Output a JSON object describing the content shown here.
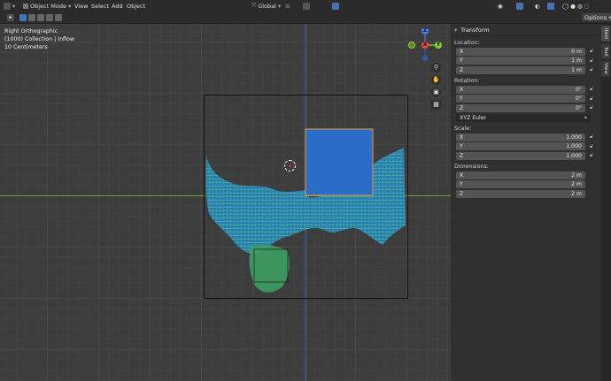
{
  "header": {
    "mode": "Object Mode",
    "menus": [
      "View",
      "Select",
      "Add",
      "Object"
    ],
    "orientation": "Global",
    "options": "Options"
  },
  "hud": {
    "view_name": "Right Orthographic",
    "collection": "(1000) Collection | Inflow",
    "scale": "10 Centimeters"
  },
  "gizmo": {
    "z": "Z",
    "y": "Y",
    "x": "X",
    "neg_y": "-Y"
  },
  "panel": {
    "title": "Transform",
    "location_label": "Location:",
    "location": [
      {
        "axis": "X",
        "value": "0 m"
      },
      {
        "axis": "Y",
        "value": "1 m"
      },
      {
        "axis": "Z",
        "value": "1 m"
      }
    ],
    "rotation_label": "Rotation:",
    "rotation": [
      {
        "axis": "X",
        "value": "0°"
      },
      {
        "axis": "Y",
        "value": "0°"
      },
      {
        "axis": "Z",
        "value": "0°"
      }
    ],
    "rotation_mode": "XYZ Euler",
    "scale_label": "Scale:",
    "scale": [
      {
        "axis": "X",
        "value": "1.000"
      },
      {
        "axis": "Y",
        "value": "1.000"
      },
      {
        "axis": "Z",
        "value": "1.000"
      }
    ],
    "dimensions_label": "Dimensions:",
    "dimensions": [
      {
        "axis": "X",
        "value": "2 m"
      },
      {
        "axis": "Y",
        "value": "2 m"
      },
      {
        "axis": "Z",
        "value": "2 m"
      }
    ]
  },
  "tabs": [
    "Item",
    "Tool",
    "View"
  ],
  "colors": {
    "accent_orange": "#e69a3a",
    "x_axis": "#e84848",
    "y_axis": "#8bd129",
    "z_axis": "#4a7ae8",
    "fluid_blue": "#2b6cc9",
    "fluid_green": "#49c24d"
  }
}
